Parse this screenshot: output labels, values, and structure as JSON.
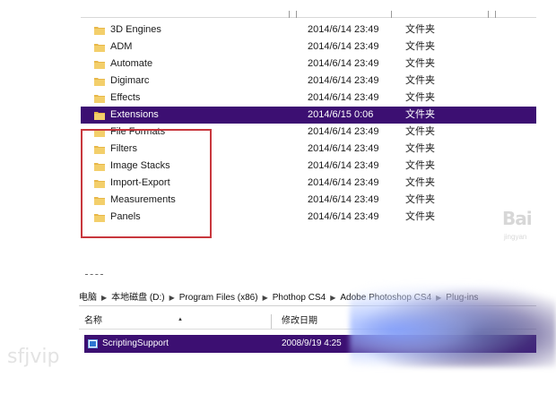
{
  "top_list": {
    "rows": [
      {
        "name": "3D Engines",
        "date": "2014/6/14 23:49",
        "type": "文件夹"
      },
      {
        "name": "ADM",
        "date": "2014/6/14 23:49",
        "type": "文件夹"
      },
      {
        "name": "Automate",
        "date": "2014/6/14 23:49",
        "type": "文件夹"
      },
      {
        "name": "Digimarc",
        "date": "2014/6/14 23:49",
        "type": "文件夹"
      },
      {
        "name": "Effects",
        "date": "2014/6/14 23:49",
        "type": "文件夹"
      },
      {
        "name": "Extensions",
        "date": "2014/6/15 0:06",
        "type": "文件夹",
        "selected": true
      },
      {
        "name": "File Formats",
        "date": "2014/6/14 23:49",
        "type": "文件夹"
      },
      {
        "name": "Filters",
        "date": "2014/6/14 23:49",
        "type": "文件夹"
      },
      {
        "name": "Image Stacks",
        "date": "2014/6/14 23:49",
        "type": "文件夹"
      },
      {
        "name": "Import-Export",
        "date": "2014/6/14 23:49",
        "type": "文件夹"
      },
      {
        "name": "Measurements",
        "date": "2014/6/14 23:49",
        "type": "文件夹"
      },
      {
        "name": "Panels",
        "date": "2014/6/14 23:49",
        "type": "文件夹"
      }
    ],
    "folder_color": "#e8b84a",
    "selected_color": "#3c0f72",
    "highlight_color": "#c8373d"
  },
  "watermarks": {
    "bai": "Bai",
    "bai_sub": "jingyan",
    "sf": "sfjvip"
  },
  "bottom_pane": {
    "breadcrumb": [
      "电脑",
      "本地磁盘 (D:)",
      "Program Files (x86)",
      "Phothop CS4",
      "Adobe Photoshop CS4",
      "Plug-ins"
    ],
    "header": {
      "name": "名称",
      "date": "修改日期"
    },
    "row": {
      "name": "ScriptingSupport",
      "date": "2008/9/19 4:25"
    }
  }
}
